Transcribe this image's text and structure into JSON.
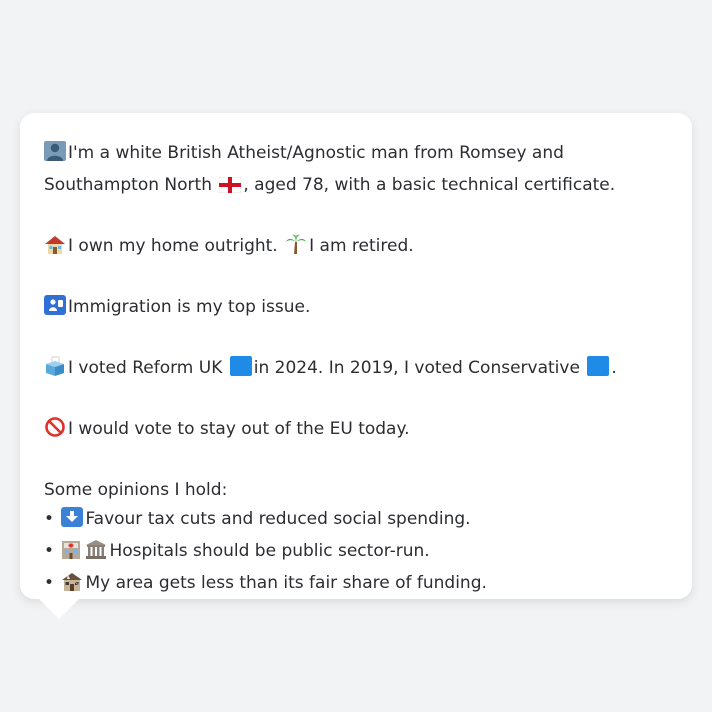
{
  "persona": {
    "identity": {
      "pre": "I'm a white British Atheist/Agnostic man from Romsey and Southampton North",
      "post": ", aged 78, with a basic technical certificate.",
      "icon": "person-silhouette-icon",
      "flag": "england-flag-icon"
    },
    "home": {
      "home_text": "I own my home outright.",
      "retired_text": "I am retired.",
      "home_icon": "house-icon",
      "retired_icon": "palm-tree-icon"
    },
    "issue": {
      "text": "Immigration is my top issue.",
      "icon": "passport-control-icon"
    },
    "vote": {
      "t1": "I voted Reform UK",
      "t2": "in 2024. In 2019, I voted Conservative",
      "t3": ".",
      "icon": "ballot-box-icon",
      "reform_color": "#1f8be6",
      "conservative_color": "#1f8be6"
    },
    "eu": {
      "text": "I would vote to stay out of the EU today.",
      "icon": "prohibited-icon"
    },
    "opinions": {
      "heading": "Some opinions I hold:",
      "bullet": "•",
      "items": [
        {
          "text": "Favour tax cuts and reduced social spending.",
          "icon": "down-arrow-icon"
        },
        {
          "text": "Hospitals should be public sector-run.",
          "icon": "hospital-and-government-icon"
        },
        {
          "text": "My area gets less than its fair share of funding.",
          "icon": "derelict-house-icon"
        }
      ]
    }
  },
  "colors": {
    "background": "#f2f3f5",
    "bubble": "#ffffff",
    "text": "#2b2d31"
  }
}
